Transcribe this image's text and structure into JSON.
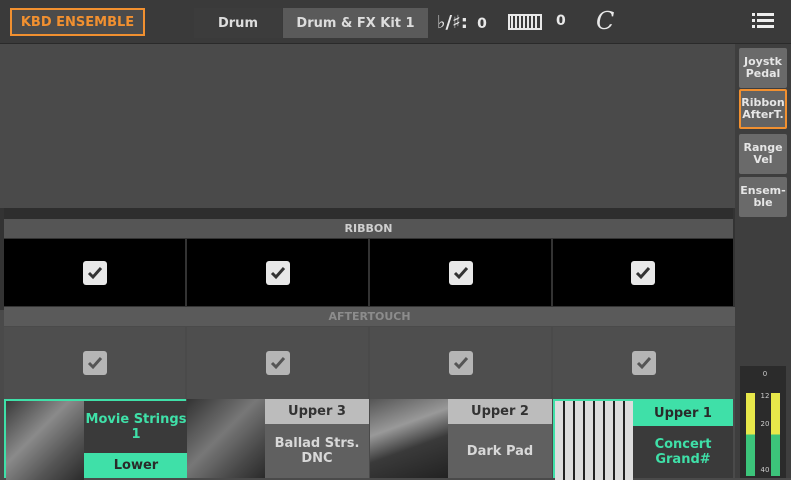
{
  "header": {
    "ensemble_button": "KBD ENSEMBLE",
    "tab_drum": "Drum",
    "tab_kit": "Drum & FX Kit 1",
    "transpose_symbol": "♭/♯:",
    "transpose_value": "0",
    "octave_value": "0",
    "meter_symbol": "C"
  },
  "side_tabs": [
    {
      "label": "Joystk Pedal",
      "selected": false
    },
    {
      "label": "Ribbon AfterT.",
      "selected": true
    },
    {
      "label": "Range Vel",
      "selected": false
    },
    {
      "label": "Ensem- ble",
      "selected": false
    }
  ],
  "ribbon": {
    "label": "RIBBON",
    "checks": [
      true,
      true,
      true,
      true
    ]
  },
  "aftertouch": {
    "label": "AFTERTOUCH",
    "checks": [
      true,
      true,
      true,
      true
    ]
  },
  "slots": [
    {
      "part": "Lower",
      "sound": "Movie Strings 1",
      "active": true
    },
    {
      "part": "Upper 3",
      "sound": "Ballad Strs. DNC",
      "active": false
    },
    {
      "part": "Upper 2",
      "sound": "Dark Pad",
      "active": false
    },
    {
      "part": "Upper 1",
      "sound": "Concert Grand#",
      "active": true
    }
  ],
  "meter": {
    "scale": [
      "0",
      "12",
      "20",
      "40"
    ],
    "level_left": 0.78,
    "level_right": 0.78
  },
  "colors": {
    "accent": "#f19030",
    "active_green": "#3fe0a8",
    "check_ribbon": "#e8e8e8",
    "check_after": "#b5b5b5"
  }
}
